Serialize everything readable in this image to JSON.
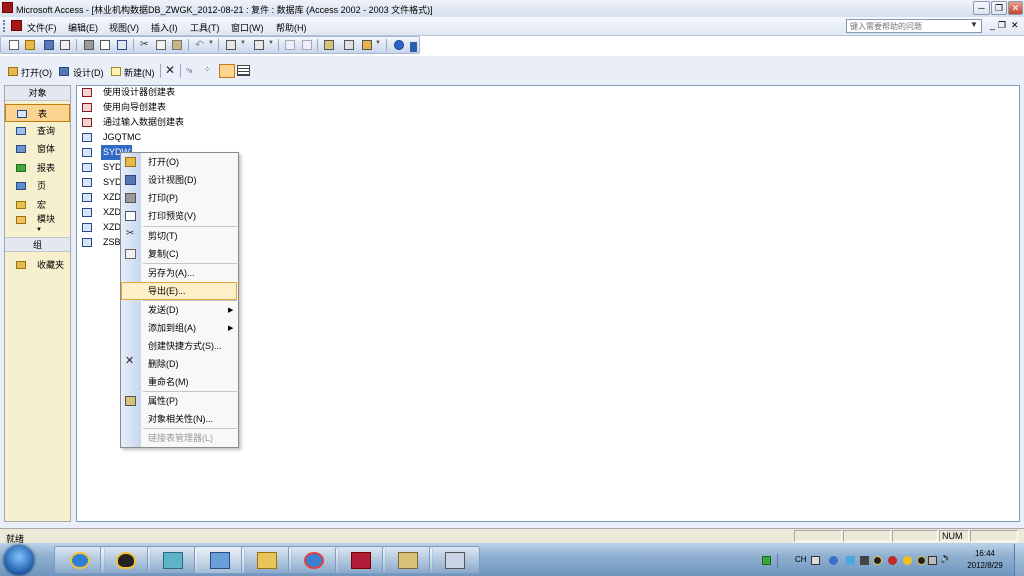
{
  "window": {
    "title": "Microsoft Access - [林业机构数据DB_ZWGK_2012-08-21 : 复件 : 数据库 (Access 2002 - 2003 文件格式)]"
  },
  "menubar": {
    "items": [
      "文件(F)",
      "编辑(E)",
      "视图(V)",
      "插入(I)",
      "工具(T)",
      "窗口(W)",
      "帮助(H)"
    ],
    "help_placeholder": "键入需要帮助的问题"
  },
  "db_toolbar": {
    "open_label": "打开(O)",
    "design_label": "设计(D)",
    "new_label": "新建(N)"
  },
  "objects_bar": {
    "header": "对象",
    "items": [
      "表",
      "查询",
      "窗体",
      "报表",
      "页",
      "宏",
      "模块"
    ],
    "group_header": "组",
    "favorites": "收藏夹"
  },
  "object_list": {
    "items": [
      "使用设计器创建表",
      "使用向导创建表",
      "通过输入数据创建表",
      "JGQTMC",
      "SYDW",
      "SYD",
      "SYD",
      "XZD",
      "XZD",
      "XZD",
      "ZSB"
    ]
  },
  "context_menu": {
    "items": [
      "打开(O)",
      "设计视图(D)",
      "打印(P)",
      "打印预览(V)",
      "剪切(T)",
      "复制(C)",
      "另存为(A)...",
      "导出(E)...",
      "发送(D)",
      "添加到组(A)",
      "创建快捷方式(S)...",
      "删除(D)",
      "重命名(M)",
      "属性(P)",
      "对象相关性(N)...",
      "链接表管理器(L)"
    ],
    "highlighted": "导出(E)..."
  },
  "statusbar": {
    "text": "就绪",
    "num": "NUM"
  },
  "taskbar": {
    "ime": "CH",
    "time": "16:44",
    "date": "2012/8/29"
  },
  "colors": {
    "accent": "#316ac5",
    "selection": "#fbd48f",
    "highlight_border": "#e4a63a"
  }
}
